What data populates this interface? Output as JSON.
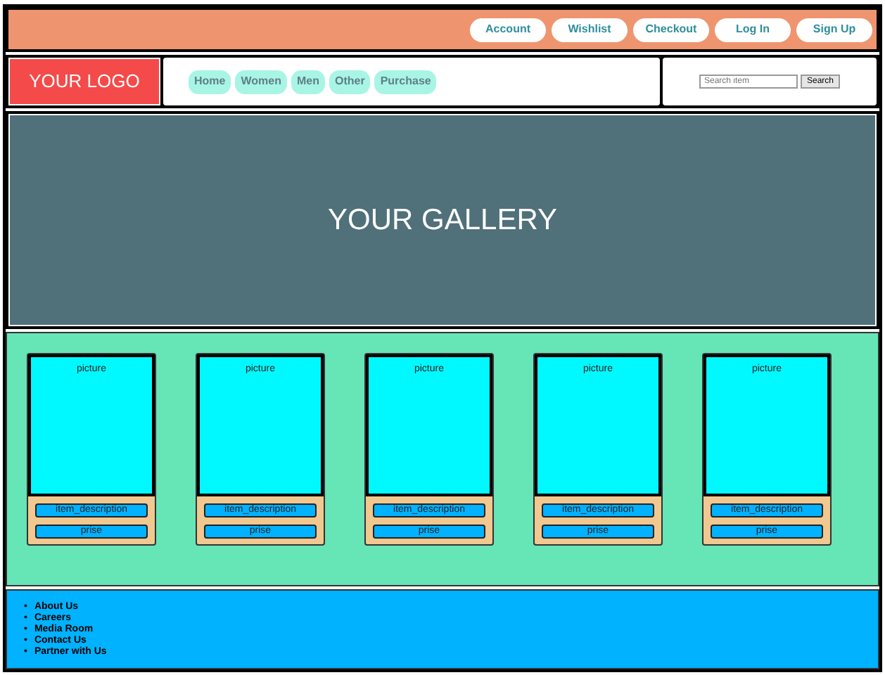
{
  "top_links": [
    "Account",
    "Wishlist",
    "Checkout",
    "Log In",
    "Sign Up"
  ],
  "logo": "YOUR LOGO",
  "nav": [
    "Home",
    "Women",
    "Men",
    "Other",
    "Purchase"
  ],
  "search": {
    "placeholder": "Search item",
    "button": "Search"
  },
  "gallery": "YOUR GALLERY",
  "products": [
    {
      "picture": "picture",
      "description": "item_description",
      "price": "prise"
    },
    {
      "picture": "picture",
      "description": "item_description",
      "price": "prise"
    },
    {
      "picture": "picture",
      "description": "item_description",
      "price": "prise"
    },
    {
      "picture": "picture",
      "description": "item_description",
      "price": "prise"
    },
    {
      "picture": "picture",
      "description": "item_description",
      "price": "prise"
    }
  ],
  "footer_links": [
    {
      "bullet": "•",
      "label": "About Us"
    },
    {
      "bullet": "•",
      "label": "Careers"
    },
    {
      "bullet": "•",
      "label": "Media Room"
    },
    {
      "bullet": "•",
      "label": "Contact Us"
    },
    {
      "bullet": "•",
      "label": "Partner with Us"
    }
  ]
}
